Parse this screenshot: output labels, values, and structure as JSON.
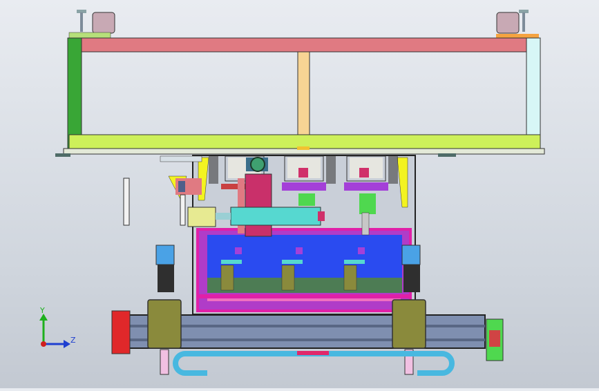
{
  "viewport": {
    "background": "#dde1e7",
    "view_axes": {
      "y_label": "Y",
      "z_label": "Z",
      "y_color": "#1db01d",
      "z_color": "#1f3fd0",
      "origin_color": "#d01f1f"
    }
  },
  "colors": {
    "top_beam": "#e07a82",
    "bottom_beam": "#cdf05a",
    "left_post": "#39a636",
    "right_post": "#d7f6f6",
    "center_post": "#f7d494",
    "frame_magenta": "#e020a8",
    "blue_panel": "#2a4bf0",
    "teal_rod": "#56d8d0",
    "olive_block": "#8a8a3c",
    "rail": "#7f8fb0",
    "cable_chain": "#48b8e0",
    "motor_red": "#e0282a",
    "fixture_green": "#4fd84f",
    "plate_pink": "#c9306a"
  }
}
